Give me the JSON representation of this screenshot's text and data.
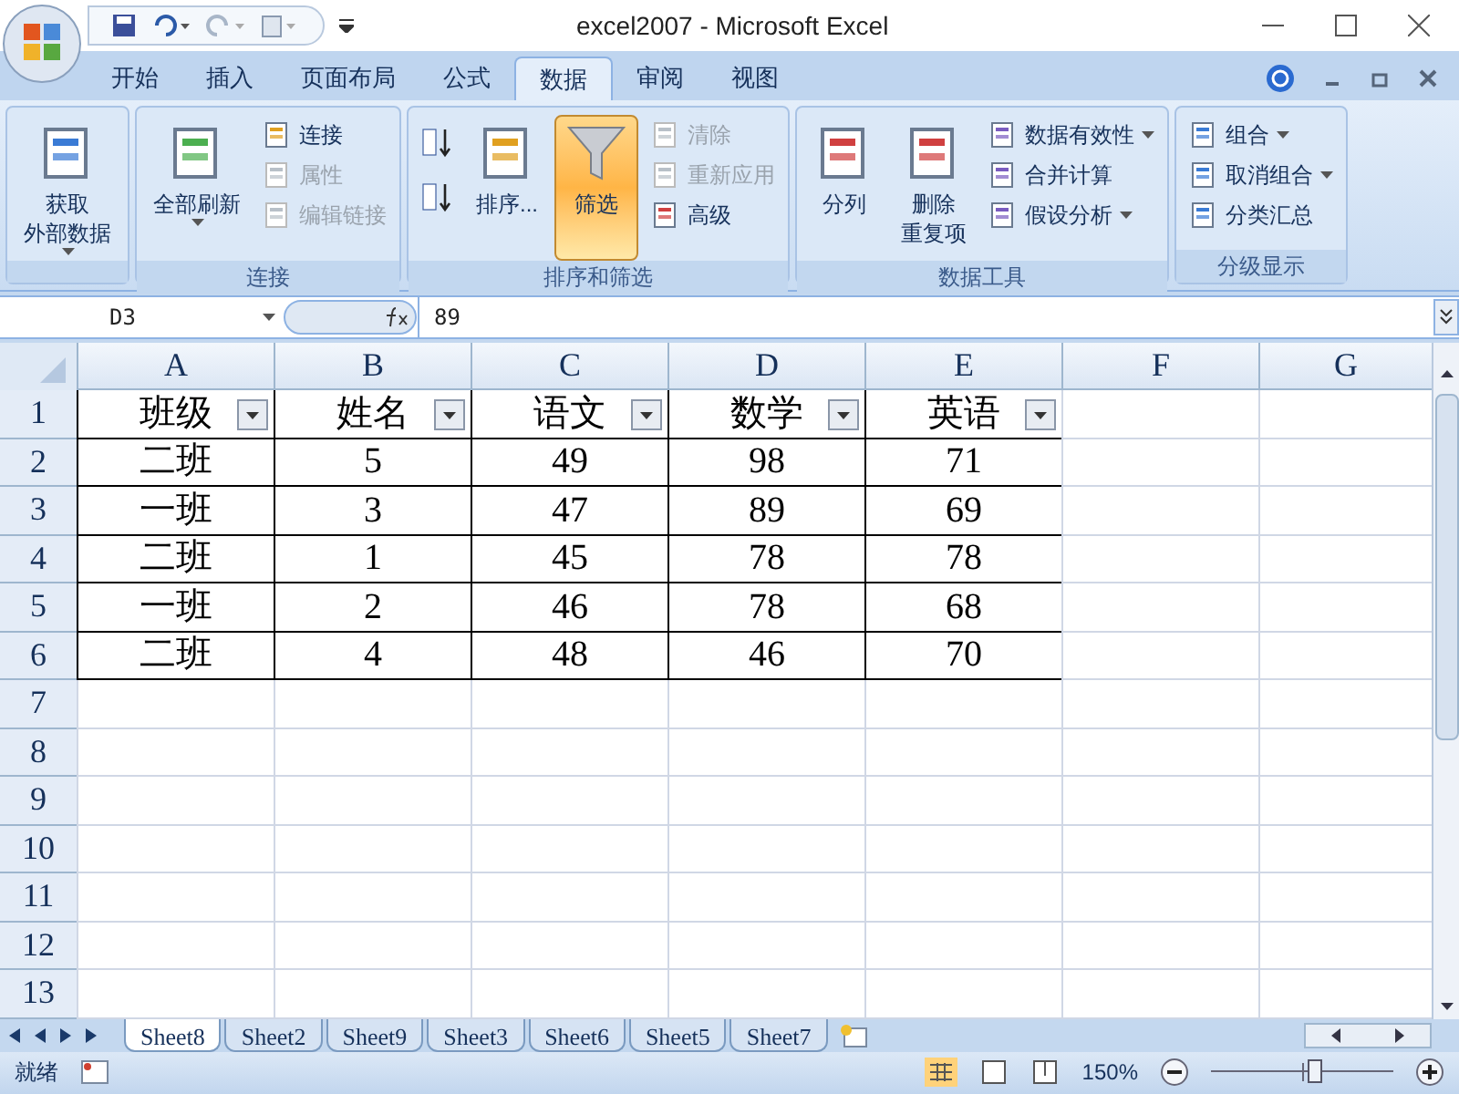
{
  "window": {
    "title": "excel2007 - Microsoft Excel"
  },
  "ribbon_tabs": [
    {
      "label": "开始",
      "selected": false
    },
    {
      "label": "插入",
      "selected": false
    },
    {
      "label": "页面布局",
      "selected": false
    },
    {
      "label": "公式",
      "selected": false
    },
    {
      "label": "数据",
      "selected": true
    },
    {
      "label": "审阅",
      "selected": false
    },
    {
      "label": "视图",
      "selected": false
    }
  ],
  "ribbon_groups": [
    {
      "columns": [
        [
          {
            "kind": "large",
            "label": "获取",
            "label2": "外部数据",
            "dropdown": true,
            "disabled": false,
            "selected": false
          }
        ]
      ]
    },
    {
      "label": "连接",
      "columns": [
        [
          {
            "kind": "large",
            "label": "全部刷新",
            "dropdown": true,
            "disabled": false,
            "selected": false
          }
        ],
        [
          {
            "kind": "small",
            "label": "连接",
            "dropdown": false,
            "disabled": false,
            "selected": false
          },
          {
            "kind": "small",
            "label": "属性",
            "dropdown": false,
            "disabled": true,
            "selected": false
          },
          {
            "kind": "small",
            "label": "编辑链接",
            "dropdown": false,
            "disabled": true,
            "selected": false
          }
        ]
      ]
    },
    {
      "label": "排序和筛选",
      "columns": [
        [
          {
            "kind": "icon",
            "dropdown": false,
            "disabled": false,
            "selected": false
          },
          {
            "kind": "icon",
            "dropdown": false,
            "disabled": false,
            "selected": false
          }
        ],
        [
          {
            "kind": "large",
            "label": "排序...",
            "dropdown": false,
            "disabled": false,
            "selected": false
          }
        ],
        [
          {
            "kind": "large",
            "label": "筛选",
            "dropdown": false,
            "disabled": false,
            "selected": true
          }
        ],
        [
          {
            "kind": "small",
            "label": "清除",
            "dropdown": false,
            "disabled": true,
            "selected": false
          },
          {
            "kind": "small",
            "label": "重新应用",
            "dropdown": false,
            "disabled": true,
            "selected": false
          },
          {
            "kind": "small",
            "label": "高级",
            "dropdown": false,
            "disabled": false,
            "selected": false
          }
        ]
      ]
    },
    {
      "label": "数据工具",
      "columns": [
        [
          {
            "kind": "large",
            "label": "分列",
            "dropdown": false,
            "disabled": false,
            "selected": false
          }
        ],
        [
          {
            "kind": "large",
            "label": "删除",
            "label2": "重复项",
            "dropdown": false,
            "disabled": false,
            "selected": false
          }
        ],
        [
          {
            "kind": "small",
            "label": "数据有效性",
            "dropdown": true,
            "disabled": false,
            "selected": false
          },
          {
            "kind": "small",
            "label": "合并计算",
            "dropdown": false,
            "disabled": false,
            "selected": false
          },
          {
            "kind": "small",
            "label": "假设分析",
            "dropdown": true,
            "disabled": false,
            "selected": false
          }
        ]
      ]
    },
    {
      "label": "分级显示",
      "columns": [
        [
          {
            "kind": "small",
            "label": "组合",
            "dropdown": true,
            "disabled": false,
            "selected": false
          },
          {
            "kind": "small",
            "label": "取消组合",
            "dropdown": true,
            "disabled": false,
            "selected": false
          },
          {
            "kind": "small",
            "label": "分类汇总",
            "dropdown": false,
            "disabled": false,
            "selected": false
          }
        ]
      ]
    }
  ],
  "name_box": "D3",
  "formula": "89",
  "columns": [
    "A",
    "B",
    "C",
    "D",
    "E",
    "F",
    "G"
  ],
  "rows": [
    {
      "number": "1",
      "kind": "header",
      "cells": [
        "班级",
        "姓名",
        "语文",
        "数学",
        "英语"
      ]
    },
    {
      "number": "2",
      "kind": "data",
      "cells": [
        "二班",
        "5",
        "49",
        "98",
        "71"
      ]
    },
    {
      "number": "3",
      "kind": "data",
      "cells": [
        "一班",
        "3",
        "47",
        "89",
        "69"
      ]
    },
    {
      "number": "4",
      "kind": "data",
      "cells": [
        "二班",
        "1",
        "45",
        "78",
        "78"
      ]
    },
    {
      "number": "5",
      "kind": "data",
      "cells": [
        "一班",
        "2",
        "46",
        "78",
        "68"
      ]
    },
    {
      "number": "6",
      "kind": "data",
      "cells": [
        "二班",
        "4",
        "48",
        "46",
        "70"
      ]
    },
    {
      "number": "7",
      "kind": "empty"
    },
    {
      "number": "8",
      "kind": "empty"
    },
    {
      "number": "9",
      "kind": "empty"
    },
    {
      "number": "10",
      "kind": "empty"
    },
    {
      "number": "11",
      "kind": "empty"
    },
    {
      "number": "12",
      "kind": "empty"
    },
    {
      "number": "13",
      "kind": "empty"
    }
  ],
  "sheet_tabs": [
    {
      "label": "Sheet8",
      "selected": true
    },
    {
      "label": "Sheet2",
      "selected": false
    },
    {
      "label": "Sheet9",
      "selected": false
    },
    {
      "label": "Sheet3",
      "selected": false
    },
    {
      "label": "Sheet6",
      "selected": false
    },
    {
      "label": "Sheet5",
      "selected": false
    },
    {
      "label": "Sheet7",
      "selected": false
    }
  ],
  "status_bar": {
    "status": "就绪",
    "zoom": "150%",
    "zoom_slider": {
      "level": 0.57
    }
  }
}
